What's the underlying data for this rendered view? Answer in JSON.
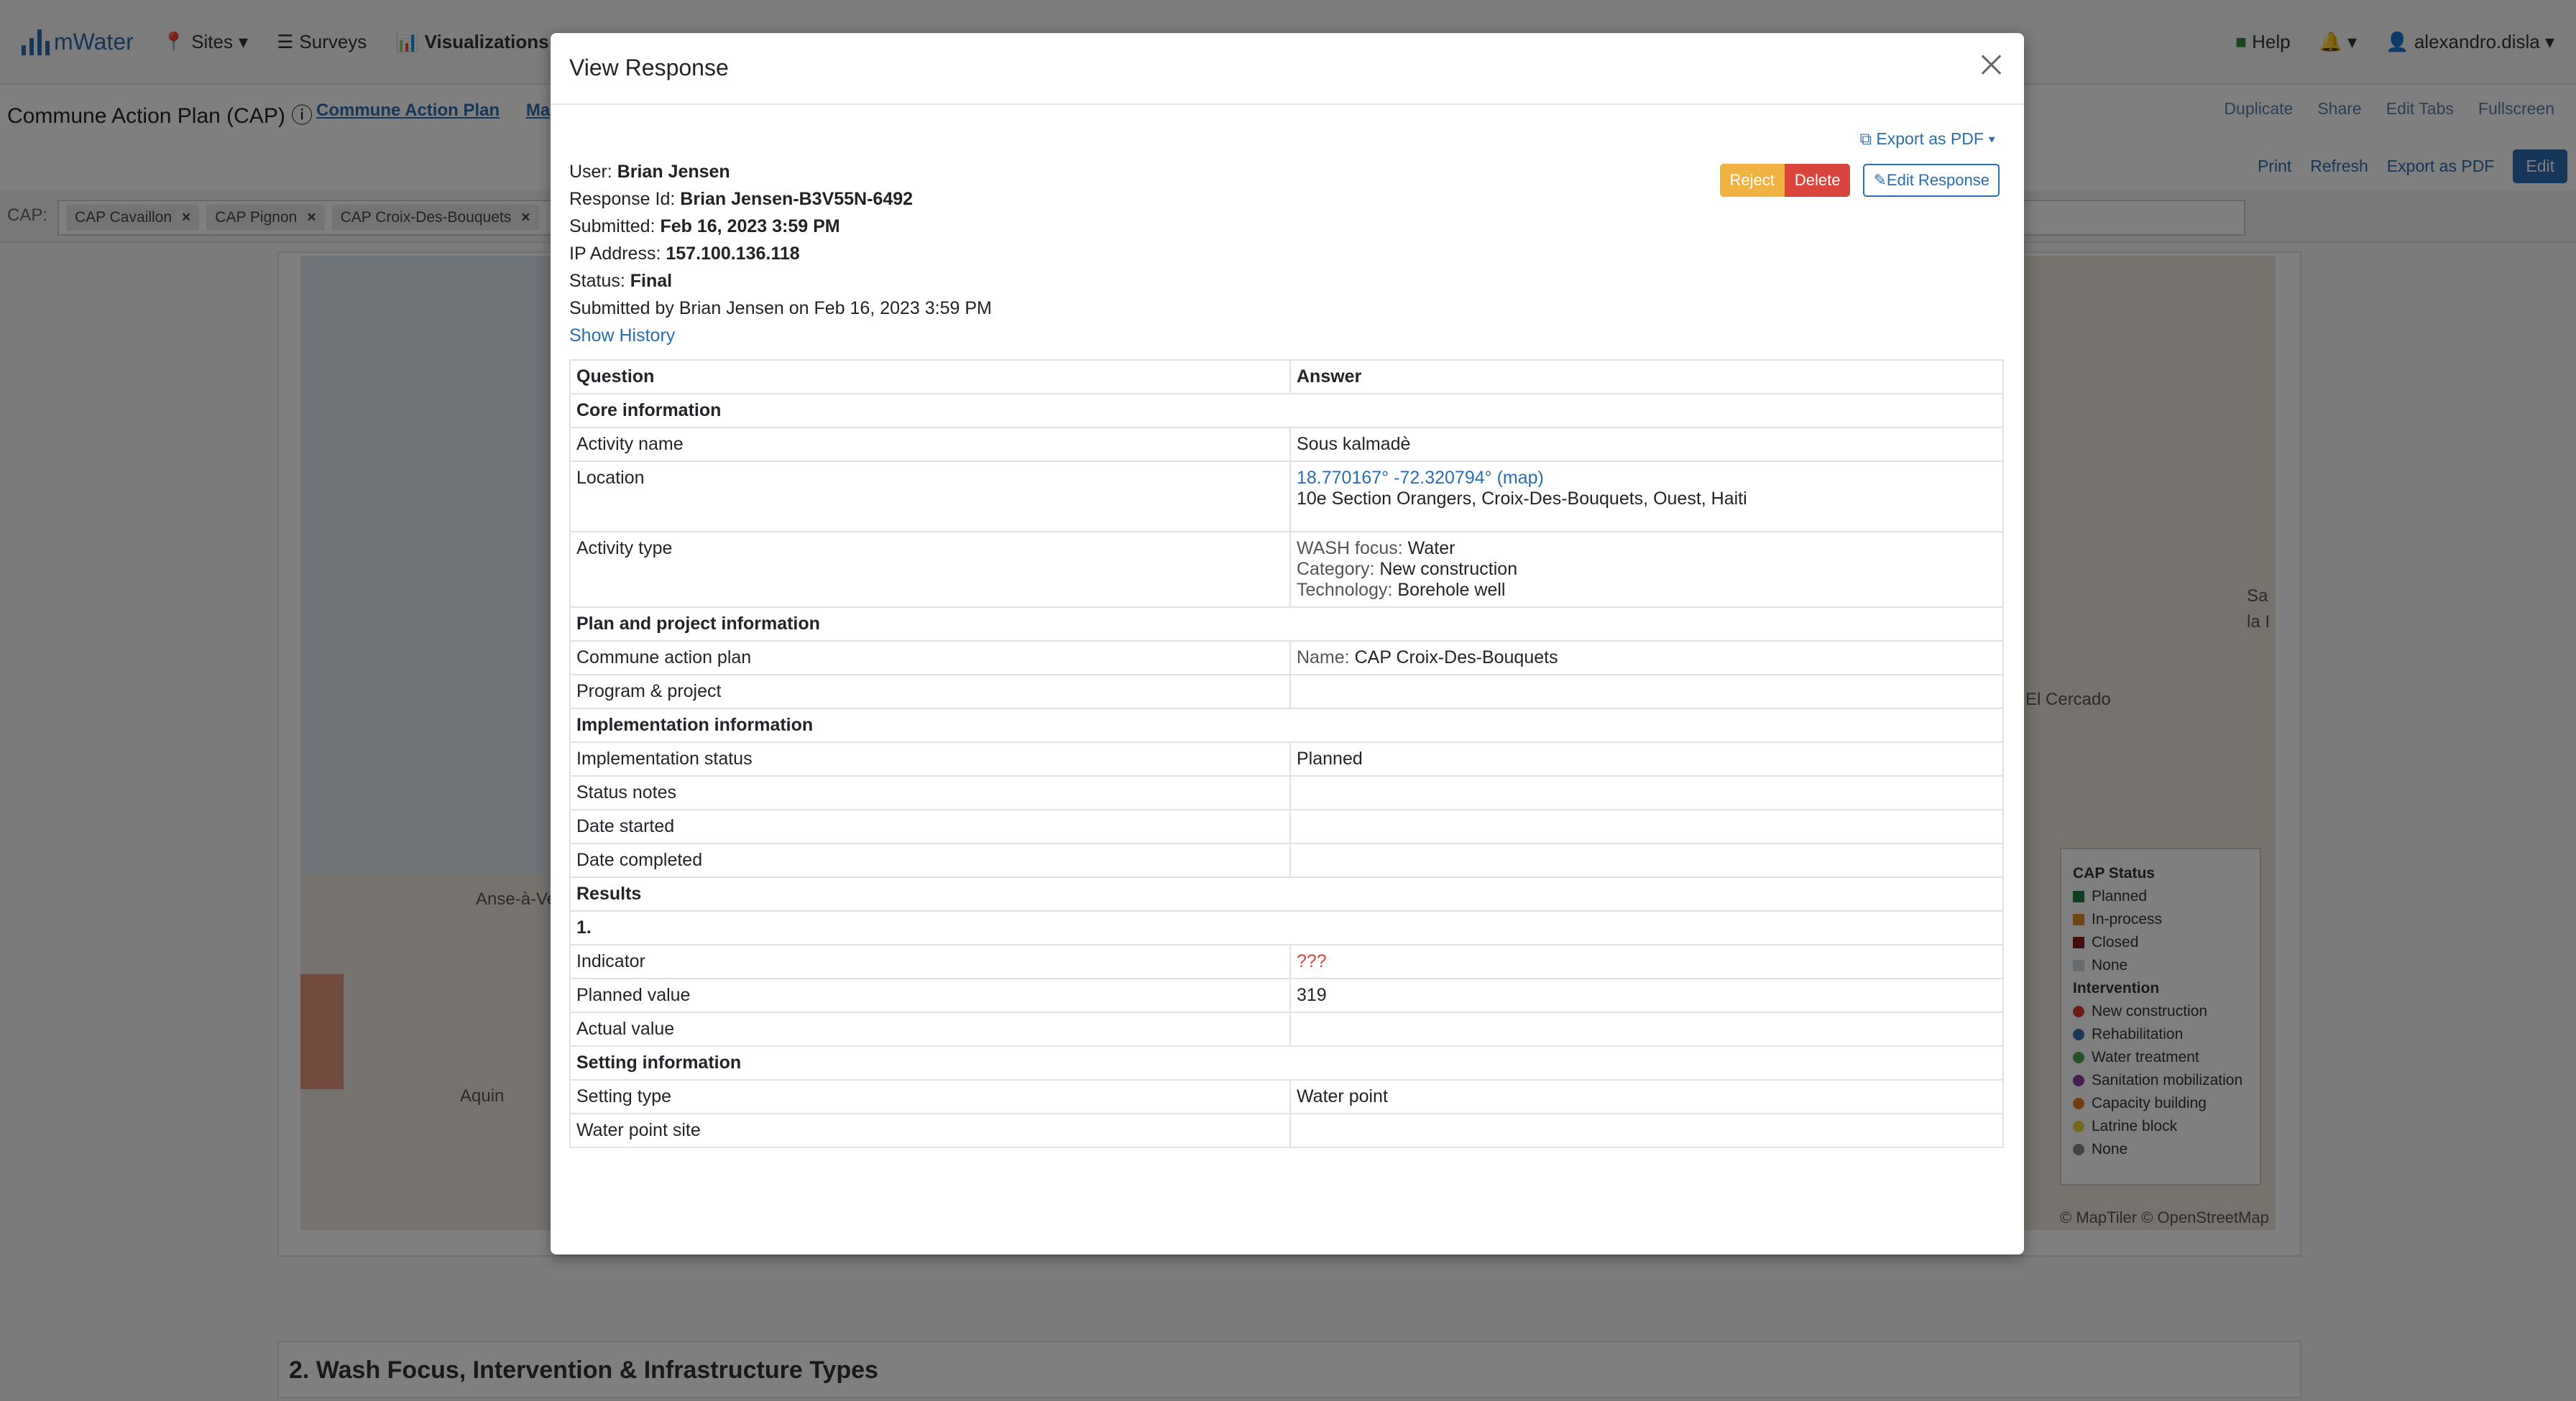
{
  "app": {
    "logo": "mWater",
    "nav": [
      "Sites",
      "Surveys",
      "Visualizations"
    ],
    "nav_right": {
      "help": "Help",
      "user": "alexandro.disla"
    }
  },
  "dashboard": {
    "title": "Commune Action Plan (CAP)",
    "tabs": [
      "Commune Action Plan",
      "Map"
    ],
    "toolbar": [
      "Duplicate",
      "Share",
      "Edit Tabs",
      "Fullscreen"
    ],
    "toolbar2": [
      "Print",
      "Refresh",
      "Export as PDF",
      "Edit"
    ],
    "filter_label": "CAP:",
    "filters": [
      "CAP Cavaillon",
      "CAP Pignon",
      "CAP Croix-Des-Bouquets"
    ],
    "section2_title": "2. Wash Focus, Intervention & Infrastructure Types",
    "map_labels": [
      "Anse-à-Ve",
      "Aquin",
      "El Cercado",
      "Sa",
      "la I"
    ],
    "map_credit": "© MapTiler © OpenStreetMap",
    "legend": {
      "status_title": "CAP Status",
      "status": [
        {
          "label": "Planned",
          "color": "#1e7b3a"
        },
        {
          "label": "In-process",
          "color": "#e58a2e"
        },
        {
          "label": "Closed",
          "color": "#8b1a1a"
        },
        {
          "label": "None",
          "color": "#cfd6de"
        }
      ],
      "intervention_title": "Intervention",
      "interventions": [
        {
          "label": "New construction",
          "color": "#d33b2f"
        },
        {
          "label": "Rehabilitation",
          "color": "#3b6fb3"
        },
        {
          "label": "Water treatment",
          "color": "#4ea34e"
        },
        {
          "label": "Sanitation mobilization",
          "color": "#8a3fa0"
        },
        {
          "label": "Capacity building",
          "color": "#e57a25"
        },
        {
          "label": "Latrine block",
          "color": "#e6d43a"
        },
        {
          "label": "None",
          "color": "#888888"
        }
      ]
    }
  },
  "modal": {
    "title": "View Response",
    "export_pdf": "Export as PDF",
    "reject": "Reject",
    "delete": "Delete",
    "edit_response": "Edit Response",
    "meta": {
      "user_label": "User:",
      "user": "Brian Jensen",
      "response_id_label": "Response Id:",
      "response_id": "Brian Jensen-B3V55N-6492",
      "submitted_label": "Submitted:",
      "submitted": "Feb 16, 2023 3:59 PM",
      "ip_label": "IP Address:",
      "ip": "157.100.136.118",
      "status_label": "Status:",
      "status": "Final",
      "submitted_by": "Submitted by Brian Jensen on Feb 16, 2023 3:59 PM",
      "show_history": "Show History"
    },
    "table": {
      "col_question": "Question",
      "col_answer": "Answer",
      "sec_core": "Core information",
      "activity_name_q": "Activity name",
      "activity_name_a": "Sous kalmadè",
      "location_q": "Location",
      "location_coords": "18.770167° -72.320794° (map)",
      "location_addr": "10e Section Orangers, Croix-Des-Bouquets, Ouest, Haiti",
      "activity_type_q": "Activity type",
      "wash_focus_label": "WASH focus:",
      "wash_focus": "Water",
      "category_label": "Category:",
      "category": "New construction",
      "technology_label": "Technology:",
      "technology": "Borehole well",
      "sec_plan": "Plan and project information",
      "cap_q": "Commune action plan",
      "cap_name_label": "Name:",
      "cap_name": "CAP Croix-Des-Bouquets",
      "program_q": "Program & project",
      "sec_impl": "Implementation information",
      "impl_status_q": "Implementation status",
      "impl_status_a": "Planned",
      "status_notes_q": "Status notes",
      "date_started_q": "Date started",
      "date_completed_q": "Date completed",
      "sec_results": "Results",
      "result_num": "1.",
      "indicator_q": "Indicator",
      "indicator_a": "???",
      "planned_value_q": "Planned value",
      "planned_value_a": "319",
      "actual_value_q": "Actual value",
      "sec_setting": "Setting information",
      "setting_type_q": "Setting type",
      "setting_type_a": "Water point",
      "water_point_site_q": "Water point site"
    }
  }
}
